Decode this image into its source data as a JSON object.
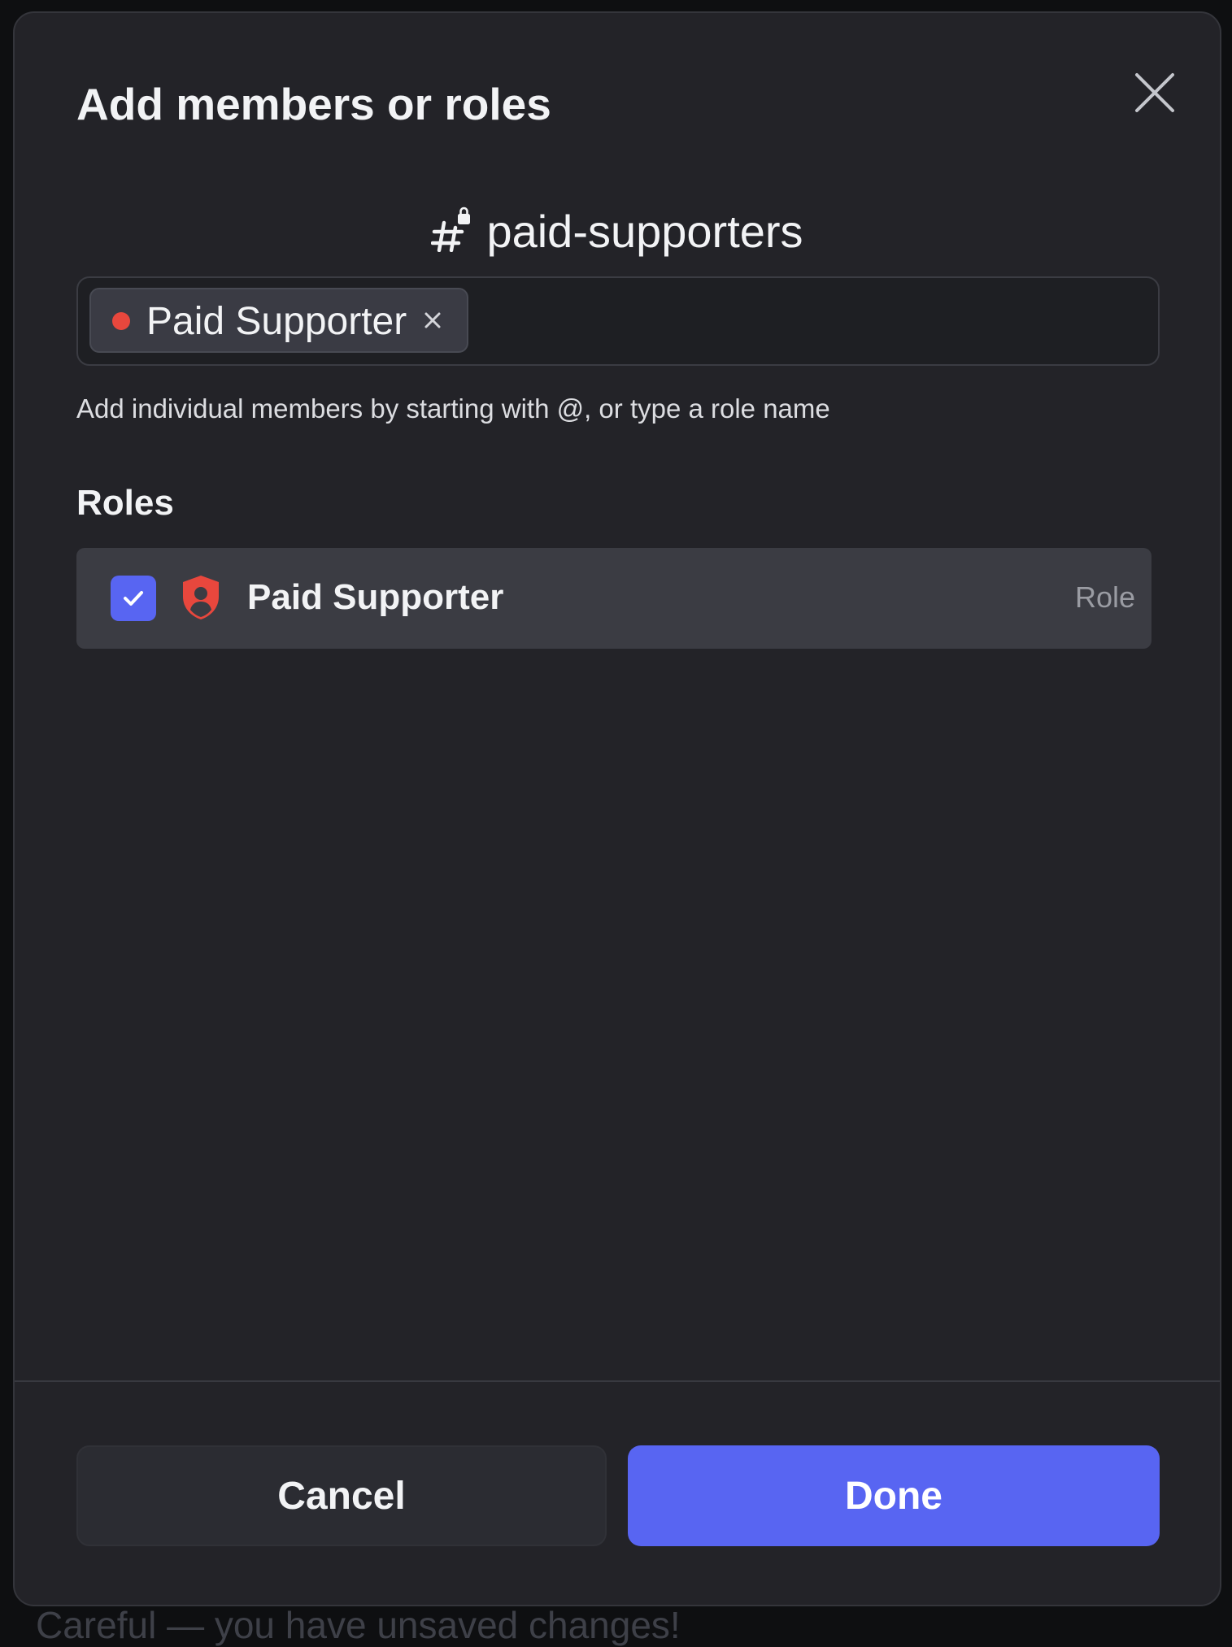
{
  "background": {
    "partial_text": "Careful — you have unsaved changes!"
  },
  "modal": {
    "title": "Add members or roles",
    "channel_name": "paid-supporters",
    "channel_icon": "locked-hashtag-icon",
    "close_icon": "close-icon"
  },
  "input": {
    "chips": [
      {
        "label": "Paid Supporter",
        "color": "#e8473d"
      }
    ],
    "hint": "Add individual members by starting with @, or type a role name"
  },
  "roles_section": {
    "heading": "Roles",
    "items": [
      {
        "name": "Paid Supporter",
        "type": "Role",
        "checked": true,
        "icon": "shield-user-icon",
        "color": "#e8473d"
      }
    ]
  },
  "footer": {
    "cancel_label": "Cancel",
    "done_label": "Done"
  },
  "colors": {
    "accent": "#5865f2",
    "role_red": "#e8473d",
    "modal_bg": "#232328"
  }
}
